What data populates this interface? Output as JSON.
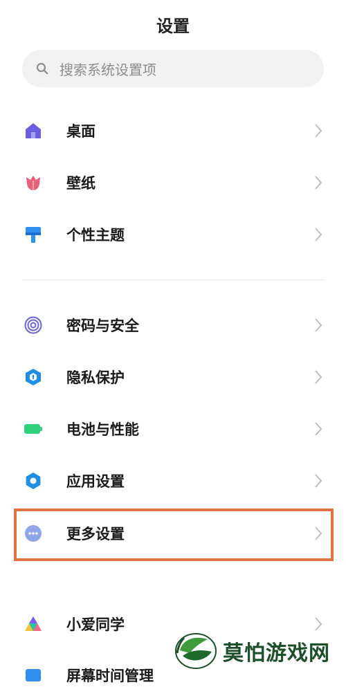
{
  "header": {
    "title": "设置"
  },
  "search": {
    "placeholder": "搜索系统设置项",
    "icon": "search-icon"
  },
  "groups": [
    {
      "items": [
        {
          "label": "桌面",
          "icon": "home-icon",
          "color": "#6b5fe0"
        },
        {
          "label": "壁纸",
          "icon": "tulip-icon",
          "color": "#e8607a"
        },
        {
          "label": "个性主题",
          "icon": "paintbrush-icon",
          "color": "#2f8ef2"
        }
      ]
    },
    {
      "items": [
        {
          "label": "密码与安全",
          "icon": "fingerprint-icon",
          "color": "#6b63d8"
        },
        {
          "label": "隐私保护",
          "icon": "privacy-shield-icon",
          "color": "#1e8fe0"
        },
        {
          "label": "电池与性能",
          "icon": "battery-icon",
          "color": "#2fd17f"
        },
        {
          "label": "应用设置",
          "icon": "gear-icon",
          "color": "#1f8fe5"
        },
        {
          "label": "更多设置",
          "icon": "more-dots-icon",
          "color": "#8fa6e8",
          "highlighted": true
        }
      ]
    },
    {
      "items": [
        {
          "label": "小爱同学",
          "icon": "xiaoai-icon",
          "color": "#2ac3a1"
        },
        {
          "label": "屏幕时间管理",
          "icon": "screen-time-icon",
          "color": "#2f8ef2"
        }
      ]
    }
  ],
  "highlight_color": "#e0723f",
  "watermark": {
    "text": "莫怕游戏网"
  }
}
